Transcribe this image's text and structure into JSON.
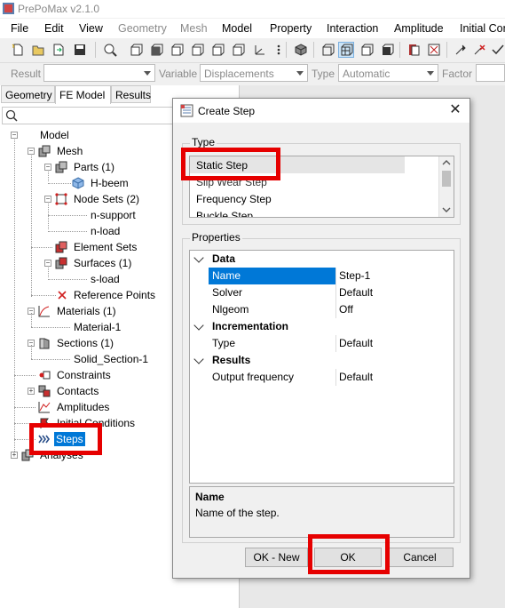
{
  "window": {
    "title": "PrePoMax v2.1.0"
  },
  "menu": [
    "File",
    "Edit",
    "View",
    "Geometry",
    "Mesh",
    "Model",
    "Property",
    "Interaction",
    "Amplitude",
    "Initial Con"
  ],
  "filterbar": {
    "result_label": "Result",
    "variable_label": "Variable",
    "variable_value": "Displacements",
    "type_label": "Type",
    "type_value": "Automatic",
    "factor_label": "Factor"
  },
  "left_panel": {
    "tabs": [
      "Geometry",
      "FE Model",
      "Results"
    ],
    "tree": {
      "model": "Model",
      "mesh": "Mesh",
      "parts": "Parts (1)",
      "part_1": "H-beem",
      "node_sets": "Node Sets (2)",
      "node_set_1": "n-support",
      "node_set_2": "n-load",
      "element_sets": "Element Sets",
      "surfaces": "Surfaces (1)",
      "surface_1": "s-load",
      "reference_points": "Reference Points",
      "materials": "Materials (1)",
      "material_1": "Material-1",
      "sections": "Sections (1)",
      "section_1": "Solid_Section-1",
      "constraints": "Constraints",
      "contacts": "Contacts",
      "amplitudes": "Amplitudes",
      "initial_conditions": "Initial Conditions",
      "steps": "Steps",
      "analyses": "Analyses"
    }
  },
  "dialog": {
    "title": "Create Step",
    "type_group": "Type",
    "type_items": [
      "Static Step",
      "Slip Wear Step",
      "Frequency Step",
      "Buckle Step"
    ],
    "properties_group": "Properties",
    "categories": {
      "data": "Data",
      "incrementation": "Incrementation",
      "results": "Results"
    },
    "properties": {
      "name": {
        "label": "Name",
        "value": "Step-1"
      },
      "solver": {
        "label": "Solver",
        "value": "Default"
      },
      "nlgeom": {
        "label": "Nlgeom",
        "value": "Off"
      },
      "type": {
        "label": "Type",
        "value": "Default"
      },
      "output_frequency": {
        "label": "Output frequency",
        "value": "Default"
      }
    },
    "description": {
      "title": "Name",
      "text": "Name of the step."
    },
    "buttons": {
      "ok_new": "OK - New",
      "ok": "OK",
      "cancel": "Cancel"
    }
  },
  "colors": {
    "highlight": "#0078d7",
    "annotation_red": "#e60000"
  }
}
